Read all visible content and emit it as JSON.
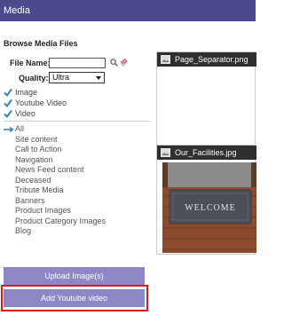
{
  "window": {
    "title": "Media"
  },
  "section_title": "Browse Media Files",
  "filters": {
    "filename_label": "File Name:",
    "filename_value": "",
    "quality_label": "Quality:",
    "quality_value": "Ultra"
  },
  "types": [
    {
      "label": "Image",
      "checked": true
    },
    {
      "label": "Youtube Video",
      "checked": true
    },
    {
      "label": "Video",
      "checked": true
    }
  ],
  "categories": [
    "All",
    "Site content",
    "Call to Action",
    "Navigation",
    "News Feed content",
    "Deceased",
    "Tribute Media",
    "Banners",
    "Product Images",
    "Product Category Images",
    "Blog"
  ],
  "thumbnails": [
    {
      "filename": "Page_Separator.png"
    },
    {
      "filename": "Our_Facilities.jpg",
      "mat_text": "WELCOME"
    }
  ],
  "buttons": {
    "upload": "Upload Image(s)",
    "youtube": "Add Youtube video"
  },
  "colors": {
    "titlebar": "#4a4a8c",
    "button": "#8e87c6",
    "highlight": "#e01818",
    "check": "#3a7fc4"
  }
}
